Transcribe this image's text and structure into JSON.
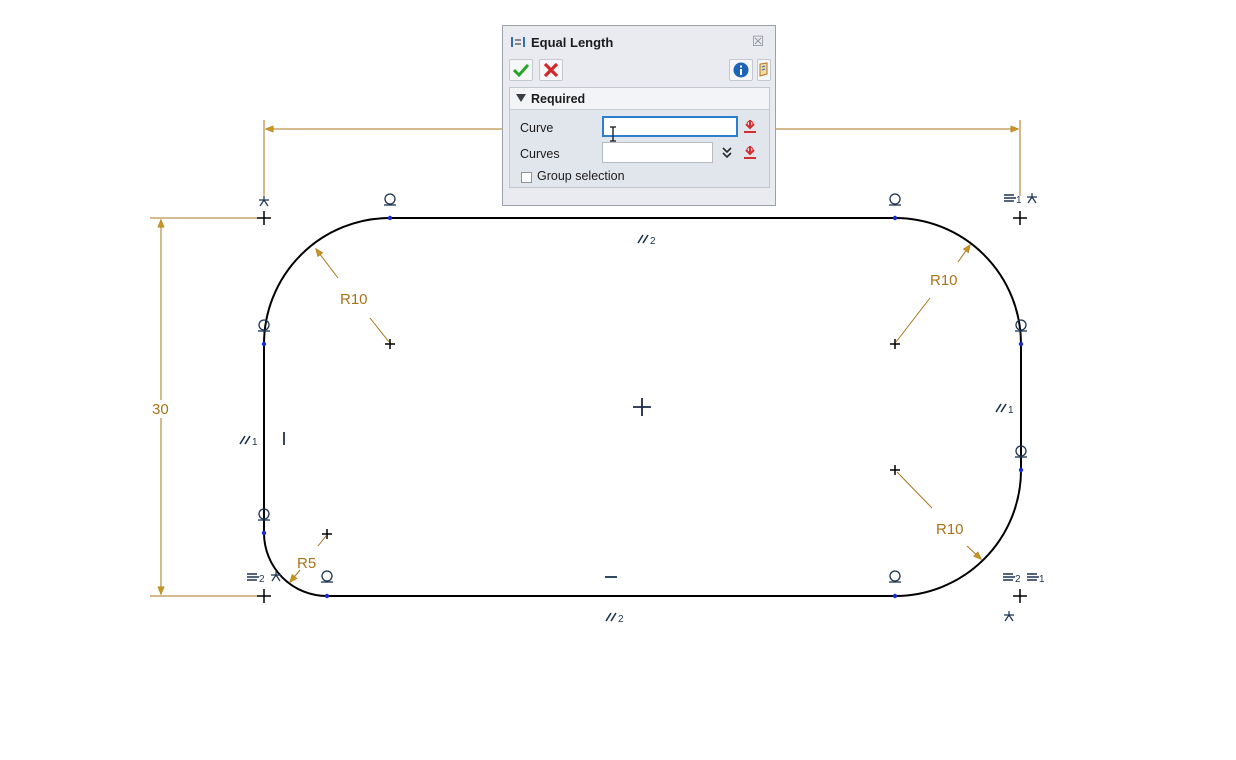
{
  "dialog": {
    "title": "Equal Length",
    "title_icon": "equal-length-icon",
    "ok_icon": "green-check-icon",
    "cancel_icon": "red-x-icon",
    "info_icon": "info-icon",
    "help_icon": "help-book-icon",
    "close_icon": "close-icon",
    "section": {
      "label": "Required",
      "expanded": true
    },
    "fields": [
      {
        "label": "Curve",
        "value": "",
        "active": true
      },
      {
        "label": "Curves",
        "value": "",
        "active": false
      }
    ],
    "group_selection": {
      "label": "Group selection",
      "checked": false
    }
  },
  "sketch": {
    "dimensions": {
      "vertical": "30",
      "radius_top_left": "R10",
      "radius_top_right": "R10",
      "radius_bottom_right": "R10",
      "radius_bottom_left": "R5"
    },
    "constraint_subscripts": {
      "parallel_top": "2",
      "parallel_bottom": "2",
      "parallel_left": "1",
      "parallel_right": "1",
      "equal_bottom_left": "2",
      "equal_top_right": "1",
      "equal_bottom_right_a": "2",
      "equal_bottom_right_b": "1"
    }
  },
  "colors": {
    "dimension": "#a8741a",
    "constraint": "#1a3350",
    "curve": "#000000",
    "point": "#1a2bd6",
    "accent_blue": "#2c7fd0"
  }
}
